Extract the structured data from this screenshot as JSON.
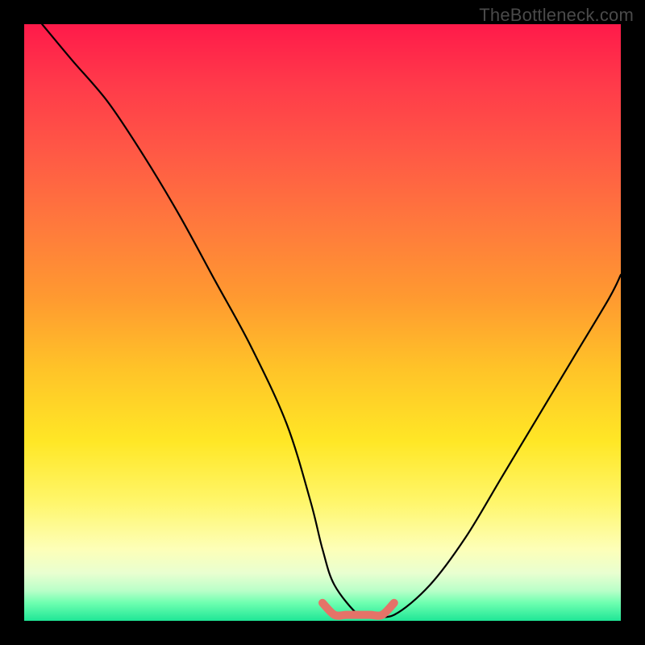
{
  "watermark": "TheBottleneck.com",
  "colors": {
    "frame": "#000000",
    "curve_stroke": "#000000",
    "flat_segment_stroke": "#e57368",
    "gradient_top": "#ff1a4a",
    "gradient_bottom": "#1fe696"
  },
  "chart_data": {
    "type": "line",
    "title": "",
    "xlabel": "",
    "ylabel": "",
    "xlim": [
      0,
      100
    ],
    "ylim": [
      0,
      100
    ],
    "grid": false,
    "legend": false,
    "annotations": [],
    "series": [
      {
        "name": "bottleneck-curve",
        "x": [
          3,
          8,
          14,
          20,
          26,
          32,
          38,
          44,
          48,
          50,
          52,
          56,
          58,
          62,
          68,
          74,
          80,
          86,
          92,
          98,
          100
        ],
        "y": [
          100,
          94,
          87,
          78,
          68,
          57,
          46,
          33,
          20,
          12,
          6,
          1,
          1,
          1,
          6,
          14,
          24,
          34,
          44,
          54,
          58
        ]
      },
      {
        "name": "optimal-flat-segment",
        "x": [
          50,
          52,
          54,
          56,
          58,
          60,
          62
        ],
        "y": [
          3,
          1,
          1,
          1,
          1,
          1,
          3
        ]
      }
    ]
  }
}
